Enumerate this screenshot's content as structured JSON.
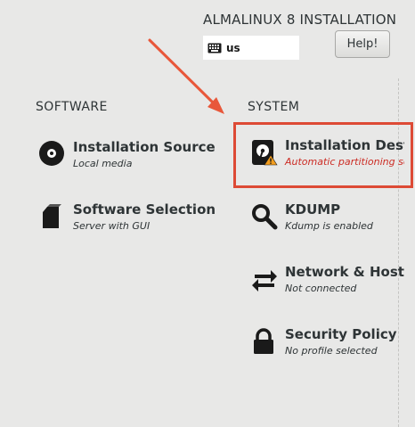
{
  "header": {
    "title": "ALMALINUX 8 INSTALLATION",
    "keyboard_layout": "us",
    "keyboard_icon": "keyboard-icon",
    "help_label": "Help!"
  },
  "software": {
    "heading": "SOFTWARE",
    "items": [
      {
        "title": "Installation Source",
        "status": "Local media",
        "icon": "disc-icon"
      },
      {
        "title": "Software Selection",
        "status": "Server with GUI",
        "icon": "package-icon"
      }
    ]
  },
  "system": {
    "heading": "SYSTEM",
    "items": [
      {
        "title": "Installation Destination",
        "status": "Automatic partitioning selected",
        "icon": "hard-drive-warning-icon",
        "status_color": "#cc2b23"
      },
      {
        "title": "KDUMP",
        "status": "Kdump is enabled",
        "icon": "magnifier-icon"
      },
      {
        "title": "Network & Host Name",
        "status": "Not connected",
        "icon": "network-arrows-icon"
      },
      {
        "title": "Security Policy",
        "status": "No profile selected",
        "icon": "lock-icon"
      }
    ]
  },
  "annotation": {
    "arrow_color": "#e8573a",
    "highlight_color": "#dd4a35"
  }
}
